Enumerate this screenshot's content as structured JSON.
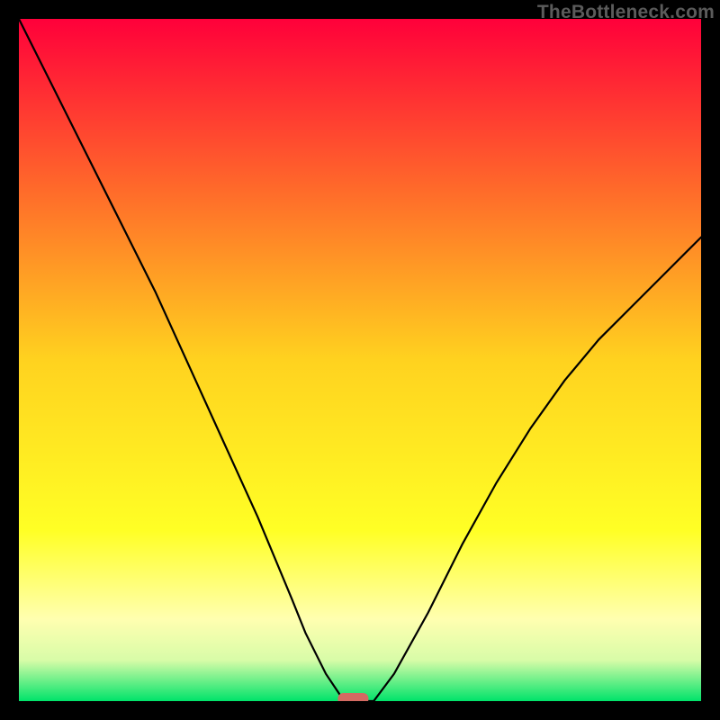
{
  "watermark": "TheBottleneck.com",
  "chart_data": {
    "type": "line",
    "title": "",
    "xlabel": "",
    "ylabel": "",
    "xlim": [
      0,
      100
    ],
    "ylim": [
      0,
      100
    ],
    "x": [
      0,
      5,
      10,
      15,
      20,
      25,
      30,
      35,
      40,
      42,
      45,
      47,
      48,
      50,
      52,
      55,
      60,
      65,
      70,
      75,
      80,
      85,
      90,
      95,
      100
    ],
    "values": [
      100,
      90,
      80,
      70,
      60,
      49,
      38,
      27,
      15,
      10,
      4,
      1,
      0,
      0,
      0,
      4,
      13,
      23,
      32,
      40,
      47,
      53,
      58,
      63,
      68
    ],
    "marker": {
      "x": 49,
      "y": 0
    },
    "gradient_stops": [
      {
        "pct": 0,
        "color": "#ff003a"
      },
      {
        "pct": 25,
        "color": "#ff6a2a"
      },
      {
        "pct": 50,
        "color": "#ffd21f"
      },
      {
        "pct": 75,
        "color": "#ffff25"
      },
      {
        "pct": 88,
        "color": "#ffffb0"
      },
      {
        "pct": 94,
        "color": "#d8fca8"
      },
      {
        "pct": 100,
        "color": "#00e36a"
      }
    ]
  }
}
